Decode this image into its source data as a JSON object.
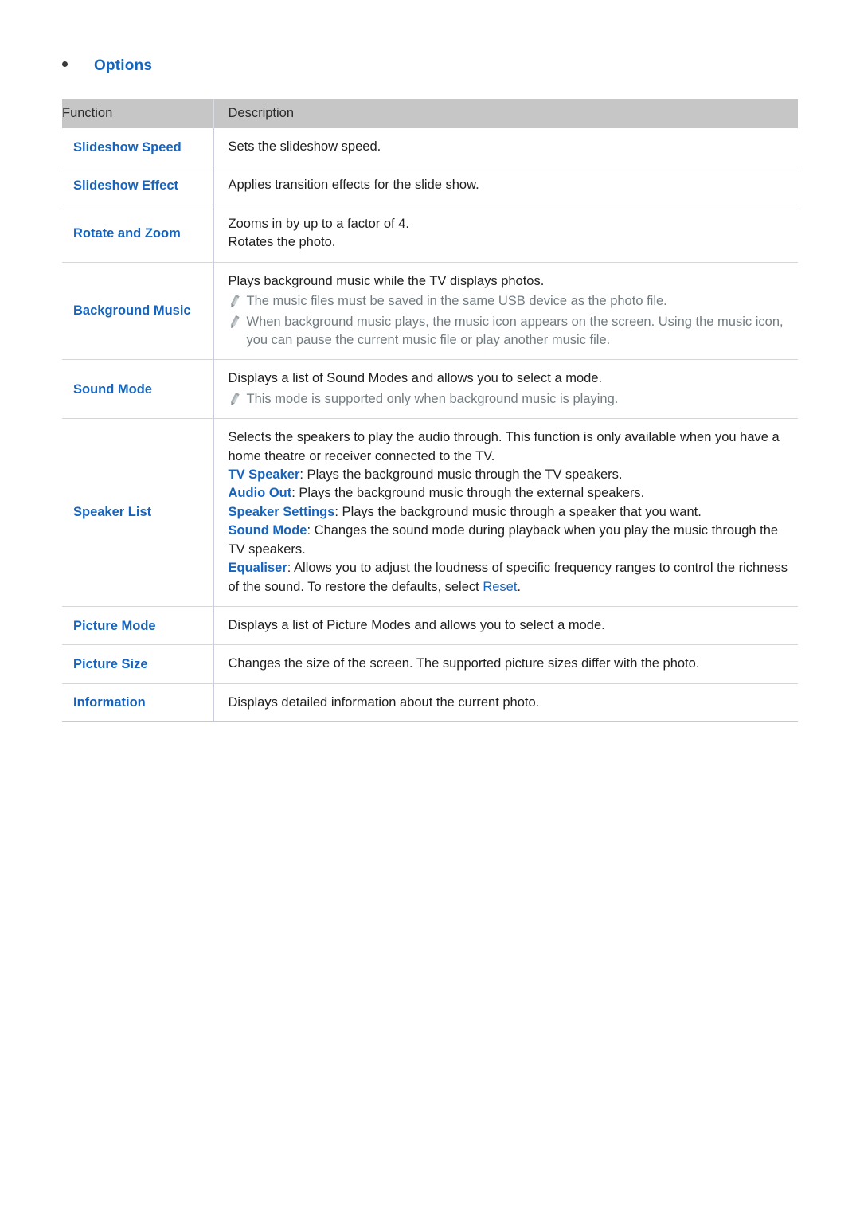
{
  "heading": {
    "bullet_icon": "bullet-dot-icon",
    "label": "Options"
  },
  "accent_colors": {
    "link_blue": "#1565c0",
    "note_gray": "#727c80",
    "header_bg": "#c6c6c6",
    "body_text": "#1f1f1f",
    "row_border": "#d6d6d6",
    "column_divider": "#c9ccdc"
  },
  "table": {
    "columns": [
      "Function",
      "Description"
    ],
    "rows": [
      {
        "function": "Slideshow Speed",
        "lines": [
          {
            "type": "text",
            "text": "Sets the slideshow speed."
          }
        ]
      },
      {
        "function": "Slideshow Effect",
        "lines": [
          {
            "type": "text",
            "text": "Applies transition effects for the slide show."
          }
        ]
      },
      {
        "function": "Rotate and Zoom",
        "lines": [
          {
            "type": "text",
            "text": "Zooms in by up to a factor of 4."
          },
          {
            "type": "text",
            "text": "Rotates the photo."
          }
        ]
      },
      {
        "function": "Background Music",
        "lines": [
          {
            "type": "text",
            "text": "Plays background music while the TV displays photos."
          },
          {
            "type": "note",
            "text": "The music files must be saved in the same USB device as the photo file."
          },
          {
            "type": "note",
            "text": "When background music plays, the music icon appears on the screen. Using the music icon, you can pause the current music file or play another music file."
          }
        ]
      },
      {
        "function": "Sound Mode",
        "lines": [
          {
            "type": "text",
            "text": "Displays a list of Sound Modes and allows you to select a mode."
          },
          {
            "type": "note",
            "text": "This mode is supported only when background music is playing."
          }
        ]
      },
      {
        "function": "Speaker List",
        "lines": [
          {
            "type": "text",
            "text": "Selects the speakers to play the audio through. This function is only available when you have a home theatre or receiver connected to the TV."
          },
          {
            "type": "labeled",
            "label": "TV Speaker",
            "text": ": Plays the background music through the TV speakers."
          },
          {
            "type": "labeled",
            "label": "Audio Out",
            "text": ": Plays the background music through the external speakers."
          },
          {
            "type": "labeled",
            "label": "Speaker Settings",
            "text": ": Plays the background music through a speaker that you want."
          },
          {
            "type": "labeled",
            "label": "Sound Mode",
            "text": ": Changes the sound mode during playback when you play the music through the TV speakers."
          },
          {
            "type": "labeled_link",
            "label": "Equaliser",
            "text": ": Allows you to adjust the loudness of specific frequency ranges to control the richness of the sound. To restore the defaults, select ",
            "link": "Reset",
            "tail": "."
          }
        ]
      },
      {
        "function": "Picture Mode",
        "lines": [
          {
            "type": "text",
            "text": "Displays a list of Picture Modes and allows you to select a mode."
          }
        ]
      },
      {
        "function": "Picture Size",
        "lines": [
          {
            "type": "text",
            "text": "Changes the size of the screen. The supported picture sizes differ with the photo."
          }
        ]
      },
      {
        "function": "Information",
        "lines": [
          {
            "type": "text",
            "text": "Displays detailed information about the current photo."
          }
        ]
      }
    ]
  }
}
